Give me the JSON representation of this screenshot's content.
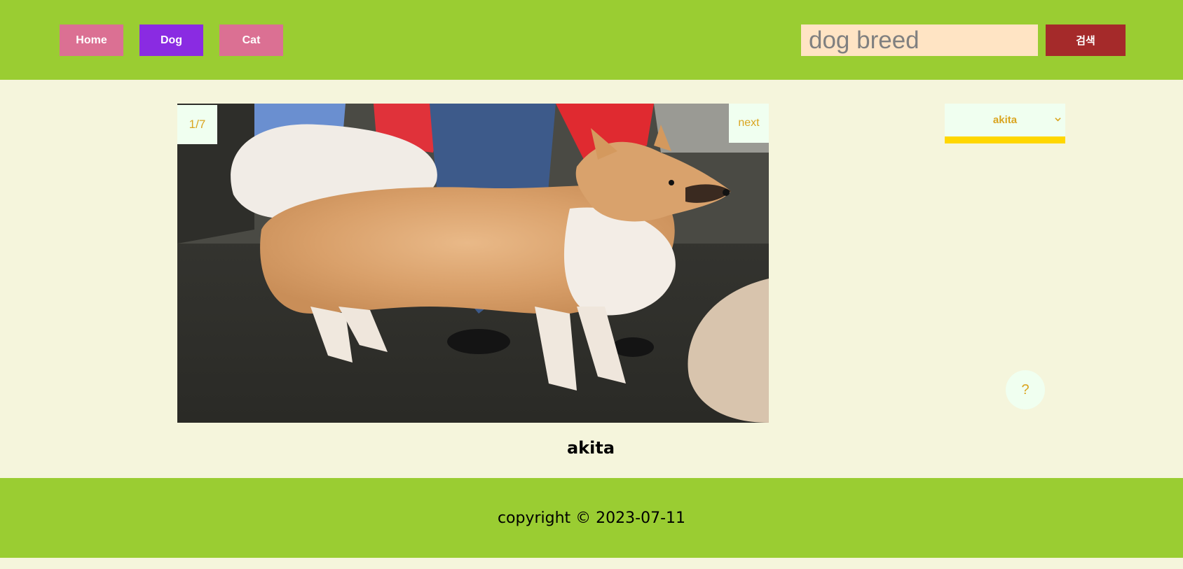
{
  "nav": {
    "home_label": "Home",
    "dog_label": "Dog",
    "cat_label": "Cat"
  },
  "search": {
    "placeholder": "dog breed",
    "button_label": "검색"
  },
  "slider": {
    "counter": "1/7",
    "next_label": "next",
    "image_alt": "akita"
  },
  "caption": "akita",
  "breed_select": {
    "selected": "akita",
    "icon": "chevron-down-icon"
  },
  "help": {
    "label": "?"
  },
  "footer": {
    "copyright": "copyright © 2023-07-11"
  },
  "colors": {
    "header_bg": "#9acd32",
    "page_bg": "#f5f5dc",
    "nav_pink": "#db7093",
    "nav_active": "#8a2be2",
    "search_bg": "#ffe4c4",
    "search_btn": "#a52a2a",
    "accent_text": "#daa520",
    "select_underline": "#ffd700"
  }
}
